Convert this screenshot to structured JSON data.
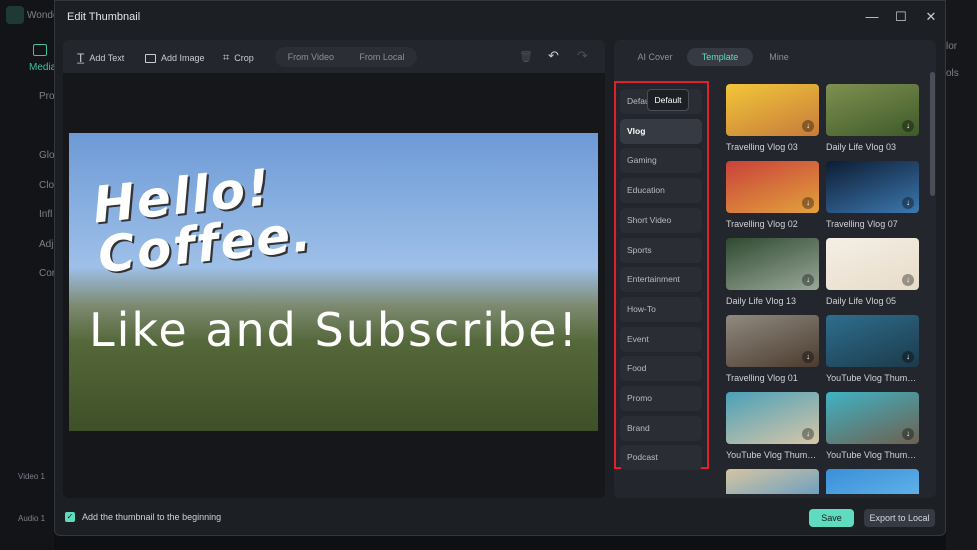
{
  "background_app": {
    "app_name": "Wonde",
    "media_tab": "Media",
    "left_items": [
      "Pro",
      "Glo",
      "Clo",
      "Infl",
      "Adj",
      "Cor"
    ],
    "tracks": [
      "Video 1",
      "Audio 1"
    ],
    "right_items": [
      "lor",
      "ols"
    ]
  },
  "dialog": {
    "title": "Edit Thumbnail",
    "window_buttons": {
      "minimize": "—",
      "maximize": "☐",
      "close": "✕"
    }
  },
  "toolbar": {
    "add_text": "Add Text",
    "add_image": "Add Image",
    "crop": "Crop",
    "from_video": "From Video",
    "from_local": "From Local"
  },
  "preview": {
    "text_1": "Hello! Coffee.",
    "text_2": "Like and Subscribe!"
  },
  "tabs": [
    {
      "label": "AI Cover"
    },
    {
      "label": "Template",
      "active": true
    },
    {
      "label": "Mine"
    }
  ],
  "categories": [
    "Default",
    "Vlog",
    "Gaming",
    "Education",
    "Short Video",
    "Sports",
    "Entertainment",
    "How-To",
    "Event",
    "Food",
    "Promo",
    "Brand",
    "Podcast"
  ],
  "selected_category": "Vlog",
  "tooltip": "Default",
  "templates": [
    {
      "label": "Travelling Vlog 03",
      "colors": [
        "#f2c63a",
        "#c77b3a"
      ]
    },
    {
      "label": "Daily Life Vlog 03",
      "colors": [
        "#7f9050",
        "#3e5a2a"
      ]
    },
    {
      "label": "Travelling Vlog 02",
      "colors": [
        "#c9413a",
        "#e3a23c"
      ]
    },
    {
      "label": "Travelling Vlog 07",
      "colors": [
        "#0d1c33",
        "#3c78b0"
      ]
    },
    {
      "label": "Daily Life Vlog 13",
      "colors": [
        "#2f4a30",
        "#9aa89a"
      ]
    },
    {
      "label": "Daily Life Vlog 05",
      "colors": [
        "#f4efe6",
        "#e8dcc8"
      ]
    },
    {
      "label": "Travelling Vlog 01",
      "colors": [
        "#8f8a80",
        "#4c3b2e"
      ]
    },
    {
      "label": "YouTube Vlog Thumb...",
      "colors": [
        "#2e6e8e",
        "#1c3a4a"
      ]
    },
    {
      "label": "YouTube Vlog Thumb...",
      "colors": [
        "#4aa0b8",
        "#d8c6a8"
      ]
    },
    {
      "label": "YouTube Vlog Thumb...",
      "colors": [
        "#3fb3c4",
        "#6e6050"
      ]
    },
    {
      "label": "",
      "colors": [
        "#d6c5a0",
        "#3f8fd0"
      ]
    },
    {
      "label": "",
      "colors": [
        "#3a8fd8",
        "#6fc0ee"
      ]
    }
  ],
  "footer": {
    "checkbox_label": "Add the thumbnail to the beginning",
    "checked": true,
    "save": "Save",
    "export": "Export to Local"
  },
  "colors": {
    "accent": "#5fdcc0",
    "highlight_box": "#e0202a"
  }
}
